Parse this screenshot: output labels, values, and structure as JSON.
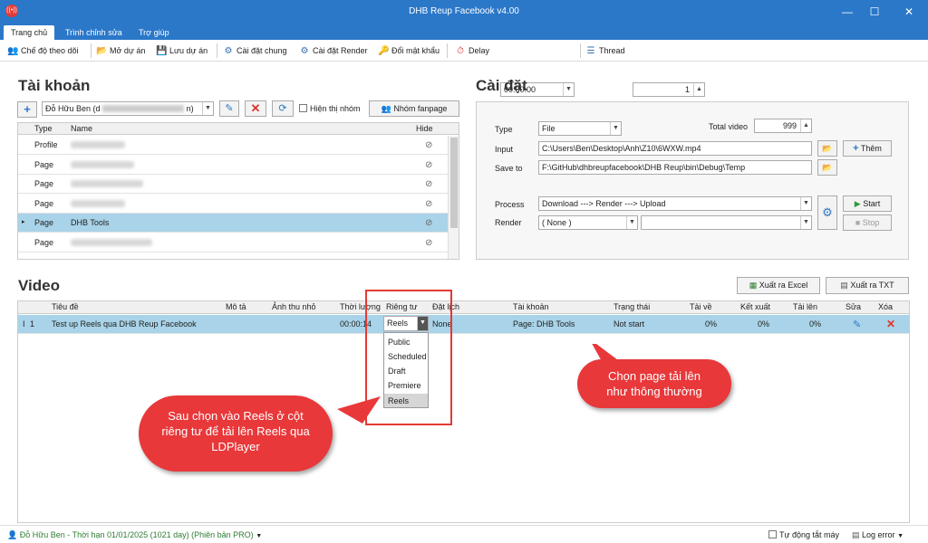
{
  "window": {
    "title": "DHB Reup Facebook v4.00"
  },
  "menu": {
    "tabs": [
      "Trang chủ",
      "Trình chỉnh sửa",
      "Trợ giúp"
    ]
  },
  "toolbar": {
    "follow_mode": "Chế độ theo dõi",
    "open_project": "Mở dự án",
    "save_project": "Lưu dự án",
    "general_settings": "Cài đặt chung",
    "render_settings": "Cài đặt Render",
    "change_password": "Đổi mật khẩu",
    "delay_label": "Delay",
    "delay_value": "00:00:00",
    "thread_label": "Thread",
    "thread_value": "1"
  },
  "account": {
    "title": "Tài khoản",
    "selected": "Đỗ Hữu Ben (d",
    "selected_suffix": "n)",
    "show_group": "Hiện thị nhóm",
    "group_fanpage": "Nhóm fanpage",
    "columns": [
      "Type",
      "Name",
      "Hide"
    ],
    "rows": [
      {
        "type": "Profile",
        "name": ""
      },
      {
        "type": "Page",
        "name": ""
      },
      {
        "type": "Page",
        "name": ""
      },
      {
        "type": "Page",
        "name": ""
      },
      {
        "type": "Page",
        "name": "DHB Tools"
      },
      {
        "type": "Page",
        "name": ""
      }
    ]
  },
  "settings": {
    "title": "Cài đặt",
    "type_label": "Type",
    "type_value": "File",
    "total_label": "Total video",
    "total_value": "999",
    "input_label": "Input",
    "input_value": "C:\\Users\\Ben\\Desktop\\Anh\\Z10\\6WXW.mp4",
    "add_btn": "Thêm",
    "saveto_label": "Save to",
    "saveto_value": "F:\\GitHub\\dhbreupfacebook\\DHB Reup\\bin\\Debug\\Temp",
    "process_label": "Process",
    "process_value": "Download ---> Render ---> Upload",
    "render_label": "Render",
    "render_value": "( None )",
    "start_btn": "Start",
    "stop_btn": "Stop"
  },
  "video": {
    "title": "Video",
    "export_excel": "Xuất ra Excel",
    "export_txt": "Xuất ra TXT",
    "columns": [
      "Tiêu đề",
      "Mô tả",
      "Ảnh thu nhỏ",
      "Thời lượng",
      "Riêng tư",
      "Đặt lịch",
      "Tài khoản",
      "Trạng thái",
      "Tải về",
      "Kết xuất",
      "Tải lên",
      "Sửa",
      "Xóa"
    ],
    "row": {
      "index": "1",
      "title": "Test up Reels qua DHB Reup Facebook",
      "duration": "00:00:14",
      "privacy": "Reels",
      "schedule": "None",
      "account": "Page: DHB Tools",
      "status": "Not start",
      "download": "0%",
      "render": "0%",
      "upload": "0%"
    },
    "privacy_options": [
      "Public",
      "Scheduled",
      "Draft",
      "Premiere",
      "Reels"
    ]
  },
  "callouts": {
    "left": "Sau chọn vào Reels ở cột riêng tư để tải lên Reels qua LDPlayer",
    "right": "Chọn page tải lên như thông thường"
  },
  "status": {
    "user": "Đỗ Hữu Ben - Thời hạn 01/01/2025 (1021 day)",
    "edition": "(Phiên bản PRO)",
    "auto_shutdown": "Tự động tắt máy",
    "log": "Log error"
  },
  "colors": {
    "accent": "#2b78c9",
    "selected_row": "#a9d3e8",
    "callout": "#e8383a",
    "highlight_box": "#e53935"
  }
}
